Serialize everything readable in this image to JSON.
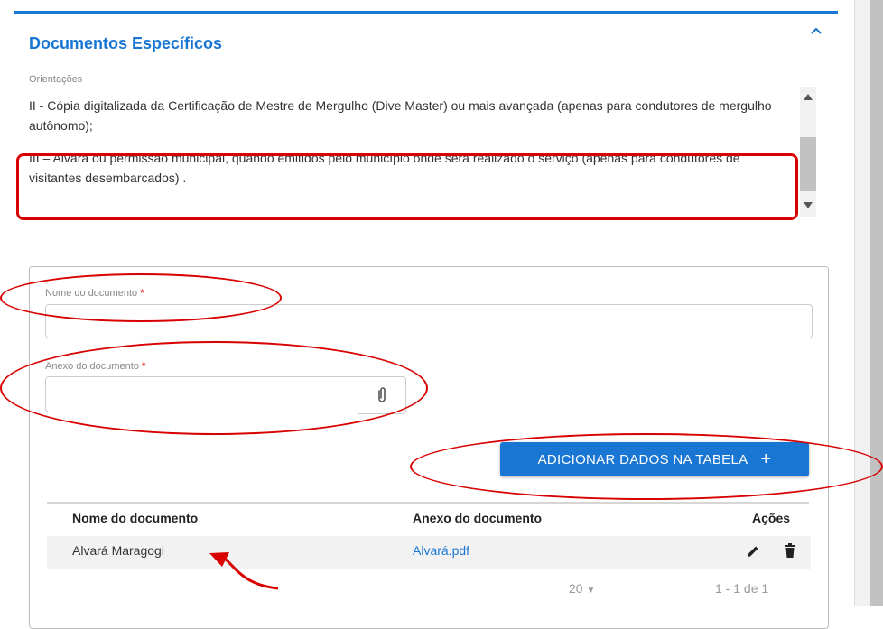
{
  "section": {
    "title": "Documentos Específicos",
    "orientations_label": "Orientações",
    "orientation_items": [
      "II - Cópia digitalizada da Certificação de Mestre de Mergulho (Dive Master) ou mais avançada (apenas para condutores de mergulho autônomo);",
      "III – Alvará ou permissão municipal, quando emitidos pelo município onde será realizado o serviço (apenas para condutores de visitantes desembarcados) ."
    ]
  },
  "form": {
    "name_label": "Nome do documento",
    "attachment_label": "Anexo do documento",
    "required_mark": "*",
    "name_value": "",
    "attachment_value": "",
    "add_button_label": "ADICIONAR DADOS NA TABELA",
    "add_button_icon": "plus-icon"
  },
  "table": {
    "headers": [
      "Nome do documento",
      "Anexo do documento",
      "Ações"
    ],
    "rows": [
      {
        "name": "Alvará Maragogi",
        "attachment": "Alvará.pdf"
      }
    ],
    "page_size": "20",
    "range": "1 - 1 de 1"
  },
  "colors": {
    "accent": "#1976d2",
    "annotation": "#d80000"
  }
}
